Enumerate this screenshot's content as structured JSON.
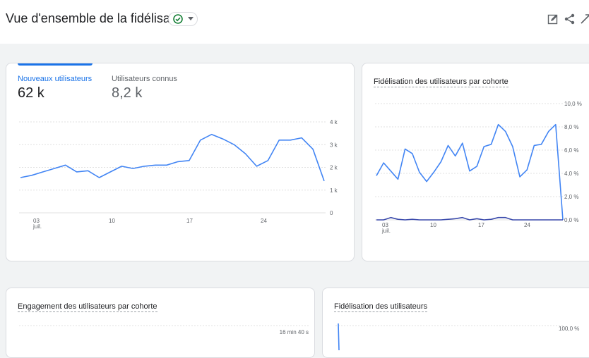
{
  "header": {
    "title": "Vue d'ensemble de la fidélisation",
    "icons": [
      "check-circle-icon",
      "chevron-down-icon",
      "edit-icon",
      "share-icon",
      "expand-icon"
    ]
  },
  "colors": {
    "accent": "#1a73e8",
    "line": "#4285f4",
    "line2": "#3949ab",
    "grid": "#e0e0e0",
    "axis": "#5f6368"
  },
  "card1": {
    "metrics": [
      {
        "label": "Nouveaux utilisateurs",
        "value": "62 k",
        "active": true
      },
      {
        "label": "Utilisateurs connus",
        "value": "8,2 k",
        "active": false
      }
    ]
  },
  "card2": {
    "title": "Fidélisation des utilisateurs par cohorte"
  },
  "card3": {
    "title": "Engagement des utilisateurs par cohorte"
  },
  "card4": {
    "title": "Fidélisation des utilisateurs"
  },
  "chart_data": [
    {
      "type": "line",
      "title": "Nouveaux utilisateurs",
      "x_ticks": [
        "03\njuil.",
        "10",
        "17",
        "24"
      ],
      "x": [
        1,
        2,
        3,
        4,
        5,
        6,
        7,
        8,
        9,
        10,
        11,
        12,
        13,
        14,
        15,
        16,
        17,
        18,
        19,
        20,
        21,
        22,
        23,
        24,
        25,
        26,
        27,
        28,
        29,
        30,
        31
      ],
      "series": [
        {
          "name": "Nouveaux utilisateurs",
          "values": [
            1.55,
            1.65,
            1.8,
            1.95,
            2.1,
            1.8,
            1.85,
            1.55,
            1.8,
            2.05,
            1.95,
            2.05,
            2.1,
            2.1,
            2.25,
            2.3,
            3.2,
            3.45,
            3.25,
            3.0,
            2.6,
            2.05,
            2.3,
            3.2,
            3.2,
            3.3,
            2.8,
            1.4
          ]
        }
      ],
      "y_ticks": [
        "0",
        "1 k",
        "2 k",
        "3 k",
        "4 k"
      ],
      "ylim": [
        0,
        4000
      ],
      "grid": true
    },
    {
      "type": "line",
      "title": "Fidélisation des utilisateurs par cohorte",
      "x_ticks": [
        "03\njuil.",
        "10",
        "17",
        "24"
      ],
      "series": [
        {
          "name": "",
          "values": [
            3.8,
            4.9,
            4.2,
            3.5,
            6.1,
            5.7,
            4.1,
            3.3,
            4.1,
            5.0,
            6.4,
            5.5,
            6.6,
            4.2,
            4.6,
            6.3,
            6.5,
            8.2,
            7.6,
            6.3,
            3.7,
            4.3,
            6.4,
            6.5,
            7.6,
            8.2,
            0.0
          ]
        },
        {
          "name": "",
          "values": [
            0.0,
            0.0,
            0.2,
            0.05,
            0.0,
            0.05,
            0.0,
            0.0,
            0.0,
            0.0,
            0.05,
            0.1,
            0.2,
            0.0,
            0.1,
            0.0,
            0.05,
            0.2,
            0.2,
            0.0,
            0.0,
            0.0,
            0.0,
            0.0,
            0.0,
            0.0,
            0.0
          ]
        }
      ],
      "y_ticks": [
        "0,0 %",
        "2,0 %",
        "4,0 %",
        "6,0 %",
        "8,0 %",
        "10,0 %"
      ],
      "ylim": [
        0,
        10
      ],
      "grid": true
    },
    {
      "type": "line",
      "title": "Engagement des utilisateurs par cohorte",
      "y_ticks": [
        "16 min 40 s"
      ]
    },
    {
      "type": "line",
      "title": "Fidélisation des utilisateurs",
      "y_ticks": [
        "100,0 %"
      ]
    }
  ]
}
